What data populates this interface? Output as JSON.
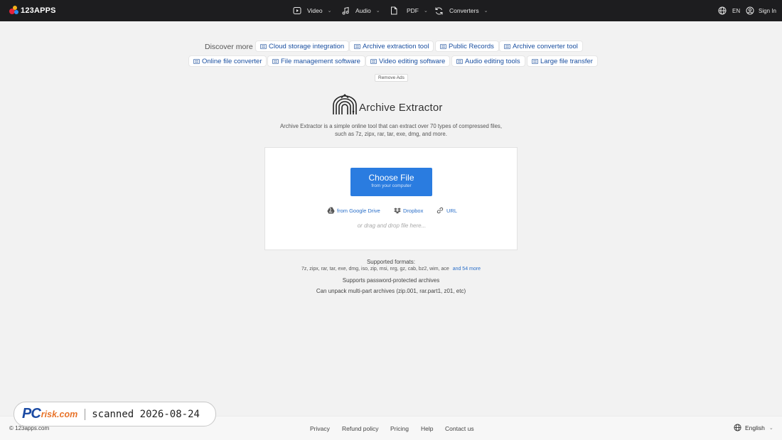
{
  "header": {
    "logo_text": "123APPS",
    "nav": [
      {
        "label": "Video",
        "icon": "video-icon"
      },
      {
        "label": "Audio",
        "icon": "audio-icon"
      },
      {
        "label": "PDF",
        "icon": "pdf-icon"
      },
      {
        "label": "Converters",
        "icon": "converters-icon"
      }
    ],
    "language": "EN",
    "sign_in": "Sign In",
    "background": "#1d1d1f"
  },
  "discover": {
    "label": "Discover more",
    "chips": [
      "Cloud storage integration",
      "Archive extraction tool",
      "Public Records",
      "Archive converter tool",
      "Online file converter",
      "File management software",
      "Video editing software",
      "Audio editing tools",
      "Large file transfer"
    ],
    "remove_ads": "Remove Ads"
  },
  "app": {
    "title": "Archive Extractor",
    "description": "Archive Extractor is a simple online tool that can extract over 70 types of compressed files, such as 7z, zipx, rar, tar, exe, dmg, and more."
  },
  "upload": {
    "button_label": "Choose File",
    "button_sublabel": "from your computer",
    "google_drive": "from Google Drive",
    "dropbox": "Dropbox",
    "url": "URL",
    "drag_hint": "or drag and drop file here...",
    "accent": "#2a7ce0"
  },
  "formats": {
    "title": "Supported formats:",
    "list": "7z, zipx, rar, tar, exe, dmg, iso, zip, msi, nrg, gz, cab, bz2, wim, ace",
    "more": "and 54 more",
    "password_line": "Supports password-protected archives",
    "multipart_line": "Can unpack multi-part archives (zip.001, rar.part1, z01, etc)"
  },
  "footer": {
    "copyright": "© 123apps.com",
    "links": [
      "Privacy",
      "Refund policy",
      "Pricing",
      "Help",
      "Contact us"
    ],
    "language": "English"
  },
  "watermark": {
    "logo_pc": "PC",
    "logo_rest": "risk.com",
    "text": "scanned 2026-08-24"
  }
}
